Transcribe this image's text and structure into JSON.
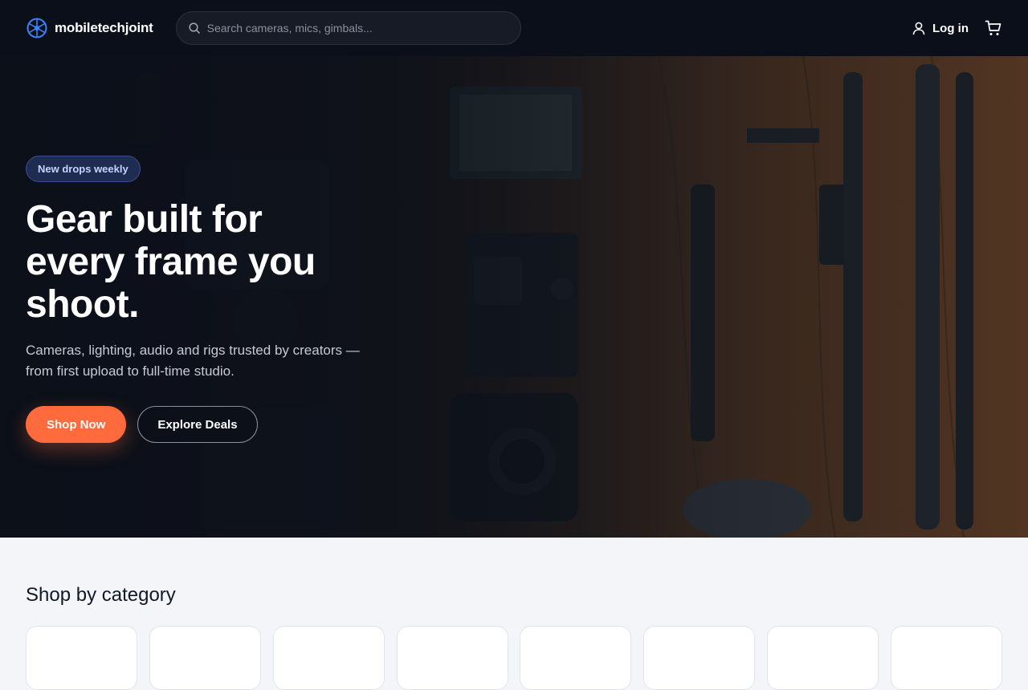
{
  "header": {
    "logo_text": "mobiletechjoint",
    "search_placeholder": "Search cameras, mics, gimbals...",
    "login_label": "Log in",
    "icons": [
      "aperture-logo-icon",
      "search-icon",
      "user-icon",
      "cart-icon"
    ]
  },
  "hero": {
    "badge": "New drops weekly",
    "title": "Gear built for every frame you shoot.",
    "subtitle": "Cameras, lighting, audio and rigs trusted by creators — from first upload to full-time studio.",
    "primary_cta": "Shop Now",
    "secondary_cta": "Explore Deals"
  },
  "categories": {
    "heading": "Shop by category",
    "cards_visible": 8
  },
  "colors": {
    "header_bg": "#0b0f19",
    "accent": "#ff6b3d",
    "logo_blue": "#3b82f6",
    "badge_text": "#c7d2fe",
    "page_bg": "#f4f5f9"
  }
}
